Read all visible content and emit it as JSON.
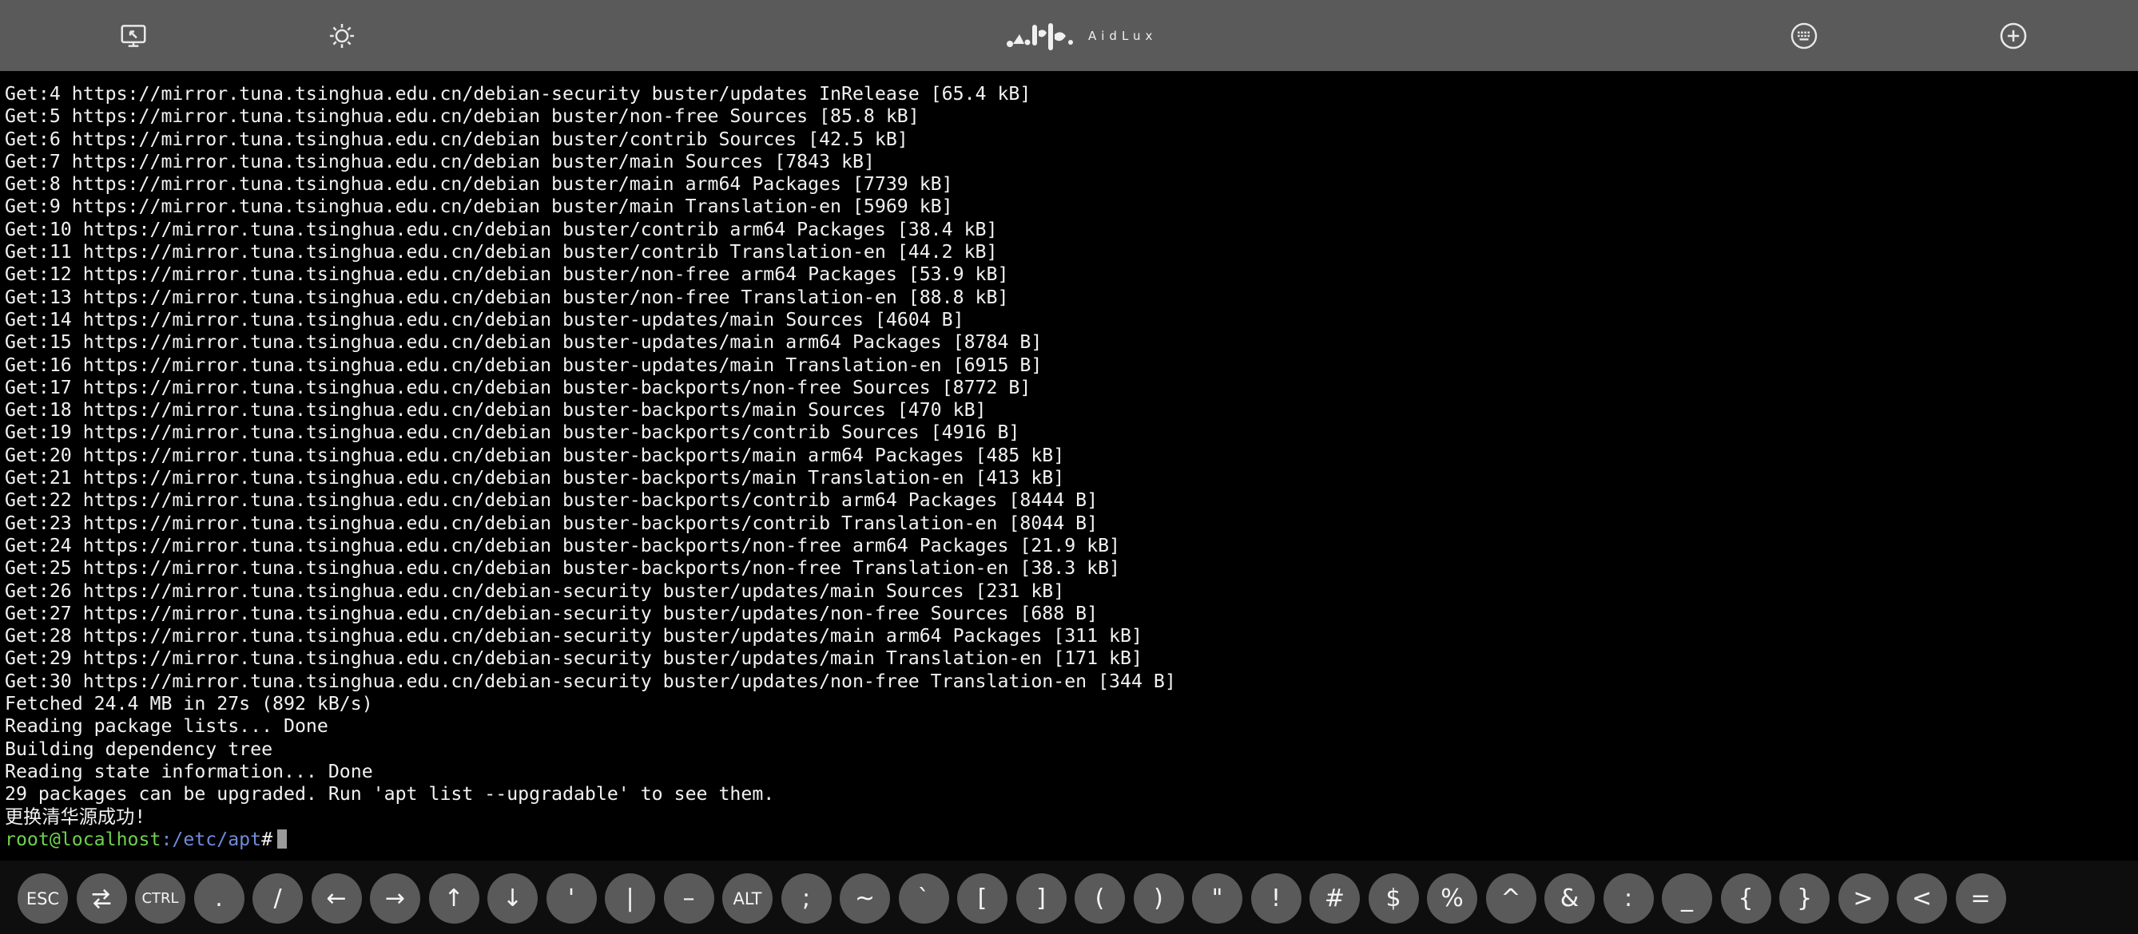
{
  "app": {
    "name": "AidLux"
  },
  "topbar": {
    "icons": [
      "screen-exit-icon",
      "brightness-icon",
      "keyboard-icon",
      "add-circle-icon"
    ]
  },
  "terminal": {
    "lines": [
      "Get:4 https://mirror.tuna.tsinghua.edu.cn/debian-security buster/updates InRelease [65.4 kB]",
      "Get:5 https://mirror.tuna.tsinghua.edu.cn/debian buster/non-free Sources [85.8 kB]",
      "Get:6 https://mirror.tuna.tsinghua.edu.cn/debian buster/contrib Sources [42.5 kB]",
      "Get:7 https://mirror.tuna.tsinghua.edu.cn/debian buster/main Sources [7843 kB]",
      "Get:8 https://mirror.tuna.tsinghua.edu.cn/debian buster/main arm64 Packages [7739 kB]",
      "Get:9 https://mirror.tuna.tsinghua.edu.cn/debian buster/main Translation-en [5969 kB]",
      "Get:10 https://mirror.tuna.tsinghua.edu.cn/debian buster/contrib arm64 Packages [38.4 kB]",
      "Get:11 https://mirror.tuna.tsinghua.edu.cn/debian buster/contrib Translation-en [44.2 kB]",
      "Get:12 https://mirror.tuna.tsinghua.edu.cn/debian buster/non-free arm64 Packages [53.9 kB]",
      "Get:13 https://mirror.tuna.tsinghua.edu.cn/debian buster/non-free Translation-en [88.8 kB]",
      "Get:14 https://mirror.tuna.tsinghua.edu.cn/debian buster-updates/main Sources [4604 B]",
      "Get:15 https://mirror.tuna.tsinghua.edu.cn/debian buster-updates/main arm64 Packages [8784 B]",
      "Get:16 https://mirror.tuna.tsinghua.edu.cn/debian buster-updates/main Translation-en [6915 B]",
      "Get:17 https://mirror.tuna.tsinghua.edu.cn/debian buster-backports/non-free Sources [8772 B]",
      "Get:18 https://mirror.tuna.tsinghua.edu.cn/debian buster-backports/main Sources [470 kB]",
      "Get:19 https://mirror.tuna.tsinghua.edu.cn/debian buster-backports/contrib Sources [4916 B]",
      "Get:20 https://mirror.tuna.tsinghua.edu.cn/debian buster-backports/main arm64 Packages [485 kB]",
      "Get:21 https://mirror.tuna.tsinghua.edu.cn/debian buster-backports/main Translation-en [413 kB]",
      "Get:22 https://mirror.tuna.tsinghua.edu.cn/debian buster-backports/contrib arm64 Packages [8444 B]",
      "Get:23 https://mirror.tuna.tsinghua.edu.cn/debian buster-backports/contrib Translation-en [8044 B]",
      "Get:24 https://mirror.tuna.tsinghua.edu.cn/debian buster-backports/non-free arm64 Packages [21.9 kB]",
      "Get:25 https://mirror.tuna.tsinghua.edu.cn/debian buster-backports/non-free Translation-en [38.3 kB]",
      "Get:26 https://mirror.tuna.tsinghua.edu.cn/debian-security buster/updates/main Sources [231 kB]",
      "Get:27 https://mirror.tuna.tsinghua.edu.cn/debian-security buster/updates/non-free Sources [688 B]",
      "Get:28 https://mirror.tuna.tsinghua.edu.cn/debian-security buster/updates/main arm64 Packages [311 kB]",
      "Get:29 https://mirror.tuna.tsinghua.edu.cn/debian-security buster/updates/main Translation-en [171 kB]",
      "Get:30 https://mirror.tuna.tsinghua.edu.cn/debian-security buster/updates/non-free Translation-en [344 B]",
      "Fetched 24.4 MB in 27s (892 kB/s)",
      "Reading package lists... Done",
      "Building dependency tree",
      "Reading state information... Done",
      "29 packages can be upgraded. Run 'apt list --upgradable' to see them.",
      "更换清华源成功!"
    ],
    "prompt": {
      "user_host": "root@localhost",
      "path": ":/etc/apt",
      "symbol": "#"
    }
  },
  "keybar": {
    "keys": [
      {
        "label": "ESC",
        "name": "key-esc"
      },
      {
        "label": "",
        "name": "key-tab",
        "icon": "tab-arrows-icon"
      },
      {
        "label": "CTRL",
        "name": "key-ctrl"
      },
      {
        "label": ".",
        "name": "key-period"
      },
      {
        "label": "/",
        "name": "key-slash"
      },
      {
        "label": "←",
        "name": "key-left"
      },
      {
        "label": "→",
        "name": "key-right"
      },
      {
        "label": "↑",
        "name": "key-up"
      },
      {
        "label": "↓",
        "name": "key-down"
      },
      {
        "label": "'",
        "name": "key-apostrophe"
      },
      {
        "label": "|",
        "name": "key-pipe"
      },
      {
        "label": "–",
        "name": "key-dash"
      },
      {
        "label": "ALT",
        "name": "key-alt"
      },
      {
        "label": ";",
        "name": "key-semicolon"
      },
      {
        "label": "~",
        "name": "key-tilde"
      },
      {
        "label": "`",
        "name": "key-backtick"
      },
      {
        "label": "[",
        "name": "key-left-bracket"
      },
      {
        "label": "]",
        "name": "key-right-bracket"
      },
      {
        "label": "(",
        "name": "key-left-paren"
      },
      {
        "label": ")",
        "name": "key-right-paren"
      },
      {
        "label": "\"",
        "name": "key-quote"
      },
      {
        "label": "!",
        "name": "key-exclamation"
      },
      {
        "label": "#",
        "name": "key-hash"
      },
      {
        "label": "$",
        "name": "key-dollar"
      },
      {
        "label": "%",
        "name": "key-percent"
      },
      {
        "label": "^",
        "name": "key-caret"
      },
      {
        "label": "&",
        "name": "key-ampersand"
      },
      {
        "label": ":",
        "name": "key-colon"
      },
      {
        "label": "_",
        "name": "key-underscore"
      },
      {
        "label": "{",
        "name": "key-left-brace"
      },
      {
        "label": "}",
        "name": "key-right-brace"
      },
      {
        "label": ">",
        "name": "key-greater"
      },
      {
        "label": "<",
        "name": "key-less"
      },
      {
        "label": "=",
        "name": "key-equals"
      }
    ]
  }
}
